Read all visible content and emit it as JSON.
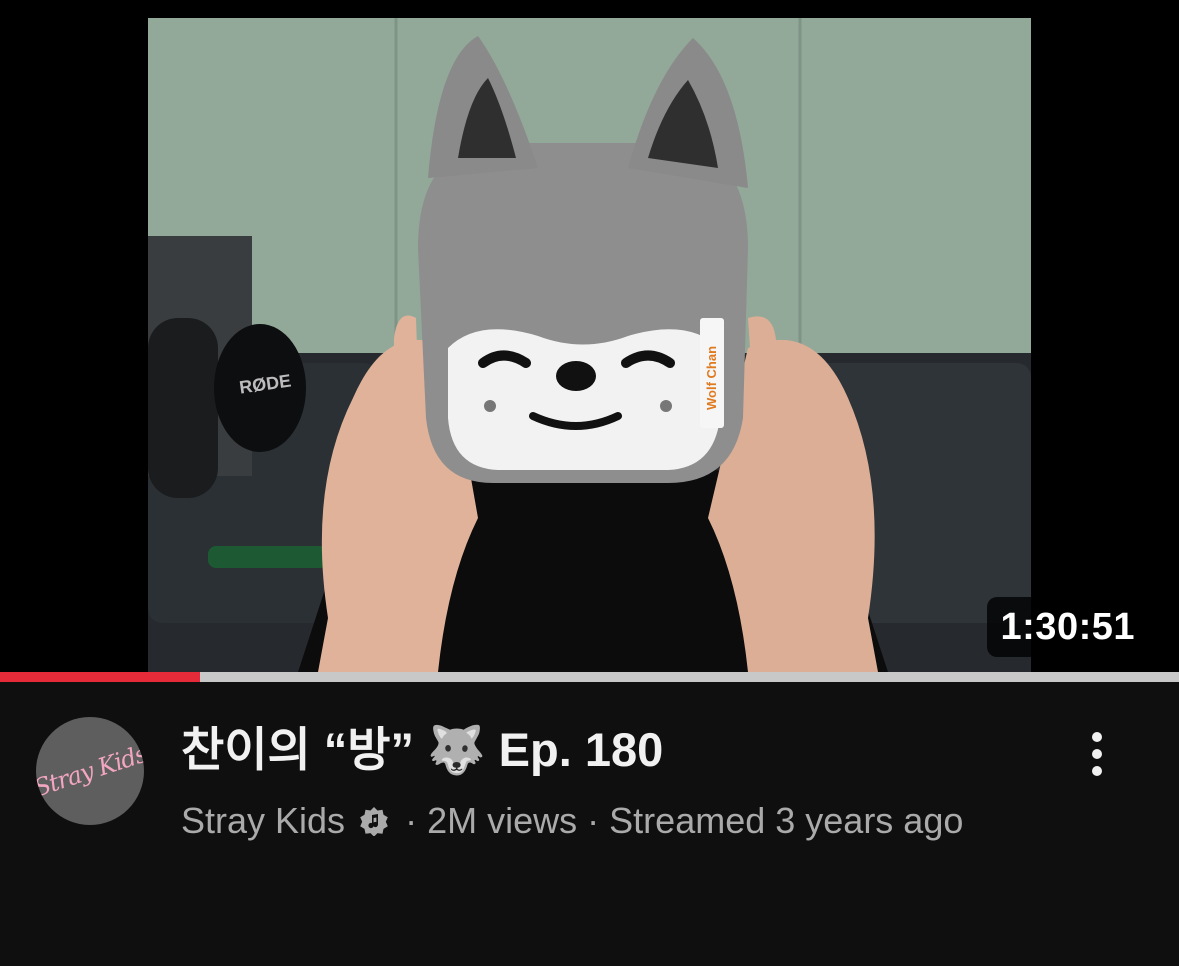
{
  "video": {
    "duration": "1:30:51",
    "progress_fraction": 0.17,
    "colors": {
      "progress": "#e52a3a",
      "progress_track": "#c8c8c8",
      "background": "#0f0f0f"
    },
    "thumbnail_text": {
      "mic_brand": "RØDE",
      "plush_tag": "Wolf Chan"
    }
  },
  "meta": {
    "title": "찬이의 “방” 🐺 Ep. 180",
    "channel": "Stray Kids",
    "verified_icon": "music-note-verified-icon",
    "separator": "·",
    "views": "2M views",
    "published": "Streamed 3 years ago",
    "avatar_logo_text": "Stray Kids",
    "more_icon": "vertical-ellipsis-icon"
  }
}
